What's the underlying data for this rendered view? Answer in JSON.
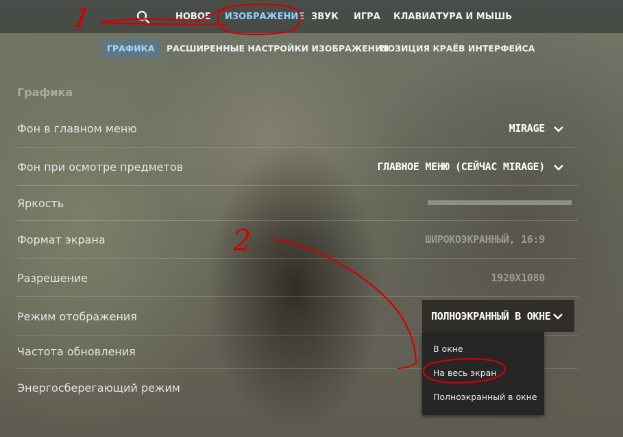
{
  "nav": {
    "items": [
      {
        "label": "НОВОЕ"
      },
      {
        "label": "ИЗОБРАЖЕНИЕ"
      },
      {
        "label": "ЗВУК"
      },
      {
        "label": "ИГРА"
      },
      {
        "label": "КЛАВИАТУРА И МЫШЬ"
      }
    ],
    "active_index": 1,
    "search_icon": "search-icon"
  },
  "subnav": {
    "items": [
      {
        "label": "ГРАФИКА"
      },
      {
        "label": "РАСШИРЕННЫЕ НАСТРОЙКИ ИЗОБРАЖЕНИЯ"
      },
      {
        "label": "ПОЗИЦИЯ КРАЁВ ИНТЕРФЕЙСА"
      }
    ],
    "active_index": 0
  },
  "section": {
    "title": "Графика"
  },
  "settings": [
    {
      "label": "Фон в главном меню",
      "value": "MIRAGE"
    },
    {
      "label": "Фон при осмотре предметов",
      "value": "ГЛАВНОЕ МЕНЮ (СЕЙЧАС MIRAGE)"
    },
    {
      "label": "Яркость"
    },
    {
      "label": "Формат экрана",
      "value": "ШИРОКОЭКРАННЫЙ, 16:9"
    },
    {
      "label": "Разрешение",
      "value": "1920X1080"
    },
    {
      "label": "Режим отображения",
      "value": "ПОЛНОЭКРАННЫЙ В ОКНЕ"
    },
    {
      "label": "Частота обновления"
    },
    {
      "label": "Энергосберегающий режим"
    }
  ],
  "display_mode_menu": {
    "options": [
      "В окне",
      "На весь экран",
      "Полноэкранный в окне"
    ]
  },
  "annotations": {
    "mark_1": "1",
    "mark_2": "2",
    "color": "#d40000"
  },
  "colors": {
    "accent": "#8fd1ff",
    "annotation": "#d40000"
  }
}
